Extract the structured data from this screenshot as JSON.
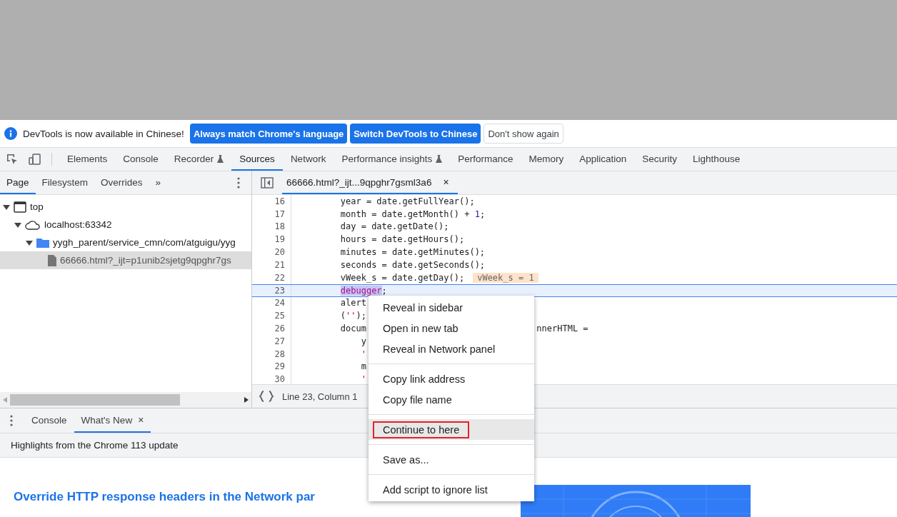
{
  "infobar": {
    "message": "DevTools is now available in Chinese!",
    "buttons": [
      {
        "label": "Always match Chrome's language",
        "kind": "primary"
      },
      {
        "label": "Switch DevTools to Chinese",
        "kind": "primary"
      },
      {
        "label": "Don't show again",
        "kind": "secondary"
      }
    ]
  },
  "main_tabs": [
    {
      "label": "Elements",
      "selected": false,
      "experimental": false
    },
    {
      "label": "Console",
      "selected": false,
      "experimental": false
    },
    {
      "label": "Recorder",
      "selected": false,
      "experimental": true
    },
    {
      "label": "Sources",
      "selected": true,
      "experimental": false
    },
    {
      "label": "Network",
      "selected": false,
      "experimental": false
    },
    {
      "label": "Performance insights",
      "selected": false,
      "experimental": true
    },
    {
      "label": "Performance",
      "selected": false,
      "experimental": false
    },
    {
      "label": "Memory",
      "selected": false,
      "experimental": false
    },
    {
      "label": "Application",
      "selected": false,
      "experimental": false
    },
    {
      "label": "Security",
      "selected": false,
      "experimental": false
    },
    {
      "label": "Lighthouse",
      "selected": false,
      "experimental": false
    }
  ],
  "navigator": {
    "tabs": [
      {
        "label": "Page",
        "selected": true
      },
      {
        "label": "Filesystem",
        "selected": false
      },
      {
        "label": "Overrides",
        "selected": false
      }
    ],
    "more": "»",
    "tree": [
      {
        "label": "top",
        "kind": "frame",
        "expanded": true,
        "selected": false,
        "children": [
          {
            "label": "localhost:63342",
            "kind": "origin",
            "expanded": true,
            "selected": false,
            "children": [
              {
                "label": "yygh_parent/service_cmn/com/atguigu/yyg",
                "kind": "folder",
                "expanded": true,
                "selected": false,
                "children": [
                  {
                    "label": "66666.html?_ijt=p1unib2sjetg9qpghr7gs",
                    "kind": "file",
                    "expanded": false,
                    "selected": true
                  }
                ]
              }
            ]
          }
        ]
      }
    ]
  },
  "editor": {
    "tab": {
      "label": "66666.html?_ijt...9qpghr7gsml3a6",
      "close": "×"
    },
    "lines": [
      {
        "number": "16",
        "current": false,
        "tokens": [
          {
            "text": "        year = date.getFullYear();",
            "kind": "plain"
          }
        ]
      },
      {
        "number": "17",
        "current": false,
        "tokens": [
          {
            "text": "        month = date.getMonth() + ",
            "kind": "plain"
          },
          {
            "text": "1",
            "kind": "number"
          },
          {
            "text": ";",
            "kind": "plain"
          }
        ]
      },
      {
        "number": "18",
        "current": false,
        "tokens": [
          {
            "text": "        day = date.getDate();",
            "kind": "plain"
          }
        ]
      },
      {
        "number": "19",
        "current": false,
        "tokens": [
          {
            "text": "        hours = date.getHours();",
            "kind": "plain"
          }
        ]
      },
      {
        "number": "20",
        "current": false,
        "tokens": [
          {
            "text": "        minutes = date.getMinutes();",
            "kind": "plain"
          }
        ]
      },
      {
        "number": "21",
        "current": false,
        "tokens": [
          {
            "text": "        seconds = date.getSeconds();",
            "kind": "plain"
          }
        ]
      },
      {
        "number": "22",
        "current": false,
        "tokens": [
          {
            "text": "        vWeek_s = date.getDay();",
            "kind": "plain"
          }
        ],
        "inline_value": "vWeek_s = 1"
      },
      {
        "number": "23",
        "current": true,
        "tokens": [
          {
            "text": "        debugger",
            "kind": "selected-keyword"
          },
          {
            "text": ";",
            "kind": "plain"
          }
        ]
      },
      {
        "number": "24",
        "current": false,
        "tokens": [
          {
            "text": "        alert",
            "kind": "plain"
          }
        ]
      },
      {
        "number": "25",
        "current": false,
        "tokens": [
          {
            "text": "        (",
            "kind": "plain"
          },
          {
            "text": "''",
            "kind": "string"
          },
          {
            "text": ");",
            "kind": "plain"
          }
        ]
      },
      {
        "number": "26",
        "current": false,
        "tokens": [
          {
            "text": "        docum",
            "kind": "plain"
          }
        ],
        "tail": "nnerHTML ="
      },
      {
        "number": "27",
        "current": false,
        "tokens": [
          {
            "text": "            y",
            "kind": "plain"
          }
        ]
      },
      {
        "number": "28",
        "current": false,
        "tokens": [
          {
            "text": "            '",
            "kind": "string"
          }
        ]
      },
      {
        "number": "29",
        "current": false,
        "tokens": [
          {
            "text": "            m",
            "kind": "plain"
          }
        ]
      },
      {
        "number": "30",
        "current": false,
        "tokens": [
          {
            "text": "            '",
            "kind": "string"
          }
        ]
      }
    ],
    "status": "Line 23, Column 1"
  },
  "drawer": {
    "tabs": [
      {
        "label": "Console",
        "selected": false,
        "close": false
      },
      {
        "label": "What's New",
        "selected": true,
        "close": true
      }
    ],
    "close": "×",
    "subtitle": "Highlights from the Chrome 113 update",
    "headline": "Override HTTP response headers in the Network par"
  },
  "context_menu": {
    "groups": [
      [
        {
          "label": "Reveal in sidebar",
          "highlighted": false,
          "outlined": false
        },
        {
          "label": "Open in new tab",
          "highlighted": false,
          "outlined": false
        },
        {
          "label": "Reveal in Network panel",
          "highlighted": false,
          "outlined": false
        }
      ],
      [
        {
          "label": "Copy link address",
          "highlighted": false,
          "outlined": false
        },
        {
          "label": "Copy file name",
          "highlighted": false,
          "outlined": false
        }
      ],
      [
        {
          "label": "Continue to here",
          "highlighted": true,
          "outlined": true
        }
      ],
      [
        {
          "label": "Save as...",
          "highlighted": false,
          "outlined": false
        }
      ],
      [
        {
          "label": "Add script to ignore list",
          "highlighted": false,
          "outlined": false
        }
      ]
    ]
  }
}
